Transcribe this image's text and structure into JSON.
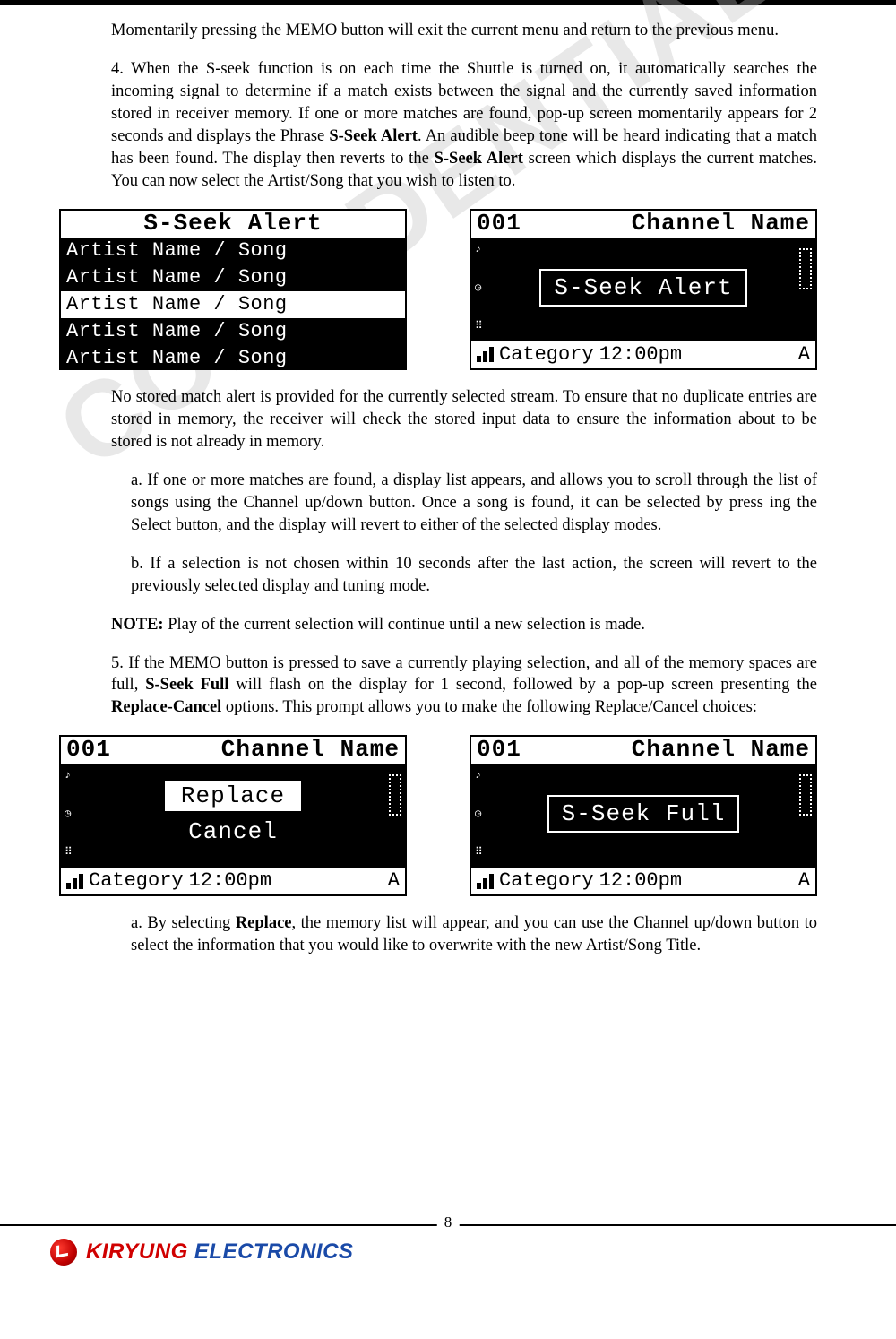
{
  "para1": "Momentarily pressing the MEMO button will exit the current menu and return to the previous menu.",
  "para2a": "4. When the S-seek function is on each time the Shuttle is turned on, it automatically searches the incoming signal to determine if a match exists between the signal and the currently saved information stored in receiver memory. If one or more matches are found, pop-up screen momentarily appears for 2 seconds and displays the Phrase ",
  "para2b": "S-Seek Alert",
  "para2c": ". An audible beep tone will be heard indicating that a match has been found. The display then reverts to the ",
  "para2d": "S-Seek Alert",
  "para2e": " screen which displays the current matches. You can now select the Artist/Song that you wish to listen to.",
  "lcdA": {
    "title": "S-Seek Alert",
    "rows": [
      "Artist Name / Song",
      "Artist Name / Song",
      "Artist Name / Song",
      "Artist Name / Song",
      "Artist Name / Song"
    ]
  },
  "lcdB": {
    "ch": "001",
    "chname": "Channel Name",
    "big": "S-Seek Alert",
    "cat": "Category",
    "time": "12:00pm",
    "ant": "A"
  },
  "para3": "No stored match alert is provided for the currently selected stream. To ensure that no duplicate entries are stored in memory, the receiver will check the stored input data to ensure the information about to be stored is not already in memory.",
  "para3a": "a. If one or more matches are found, a display list appears, and allows you to scroll through the list of songs using the Channel up/down button. Once a song is found, it can be selected by press ing the Select button, and the display will revert to either of the selected display modes.",
  "para3b": "b. If a selection is not chosen within 10 seconds after the last action, the screen will revert to the previously selected display and tuning mode.",
  "note_label": "NOTE:",
  "note_text": " Play of the current selection will continue until a new selection is made.",
  "para5a": "5. If the MEMO button is pressed to save a currently playing selection, and all of the memory spaces are full, ",
  "para5b": "S-Seek Full",
  "para5c": " will flash on the display for 1 second, followed by a pop-up screen presenting the ",
  "para5d": "Replace-Cancel",
  "para5e": " options. This prompt allows you to make the following Replace/Cancel choices:",
  "lcdC": {
    "ch": "001",
    "chname": "Channel Name",
    "opt1": "Replace",
    "opt2": "Cancel",
    "cat": "Category",
    "time": "12:00pm",
    "ant": "A"
  },
  "lcdD": {
    "ch": "001",
    "chname": "Channel Name",
    "big": "S-Seek Full",
    "cat": "Category",
    "time": "12:00pm",
    "ant": "A"
  },
  "para6a": "a. By selecting ",
  "para6b": "Replace",
  "para6c": ", the memory list will appear, and you can use the Channel up/down button to select the information that you would like to overwrite with the new Artist/Song Title.",
  "pagenum": "8",
  "brand1": "KIRYUNG",
  "brand2": " ELECTRONICS",
  "watermark": "CONFIDENTIAL"
}
